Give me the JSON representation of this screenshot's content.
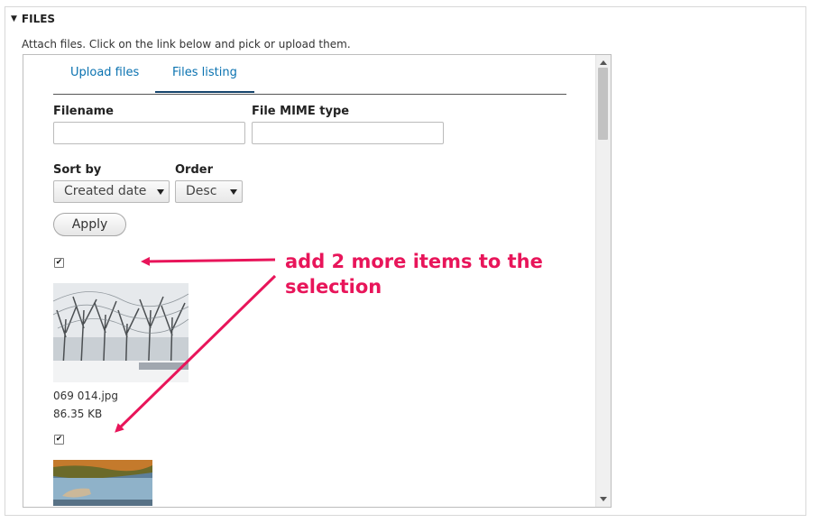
{
  "section": {
    "legend": "FILES",
    "description": "Attach files. Click on the link below and pick or upload them."
  },
  "tabs": [
    {
      "label": "Upload files",
      "active": false
    },
    {
      "label": "Files listing",
      "active": true
    }
  ],
  "filters": {
    "filename_label": "Filename",
    "filename_value": "",
    "mime_label": "File MIME type",
    "mime_value": "",
    "sort_label": "Sort by",
    "sort_value": "Created date",
    "order_label": "Order",
    "order_value": "Desc",
    "apply_label": "Apply"
  },
  "files": [
    {
      "name": "069 014.jpg",
      "size": "86.35 KB",
      "checked": true
    },
    {
      "name": "",
      "size": "",
      "checked": true
    }
  ],
  "annotation": {
    "line1": "add 2 more items to the",
    "line2": "selection",
    "color": "#e8155a"
  }
}
